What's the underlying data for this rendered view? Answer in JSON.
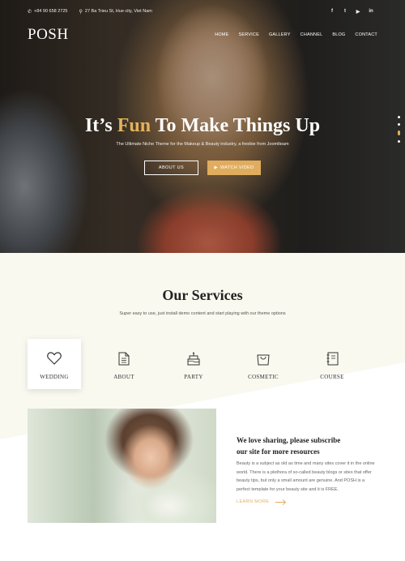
{
  "topbar": {
    "phone": "+84 90 658 2725",
    "address": "27 Ba Trieu St, Hue city, Viet Nam",
    "socials": [
      "f",
      "t",
      "▶",
      "in"
    ]
  },
  "header": {
    "logo": "POSH",
    "nav": [
      "HOME",
      "SERVICE",
      "GALLERY",
      "CHANNEL",
      "BLOG",
      "CONTACT"
    ]
  },
  "hero": {
    "title_before": "It’s ",
    "title_highlight": "Fun",
    "title_after": " To Make Things Up",
    "subtitle": "The Ultimate Niche Theme for the Makeup & Beauty industry, a freebie from Joomlteam",
    "btn_about": "ABOUT US",
    "btn_video": "WATCH VIDEO",
    "slides": 4,
    "active_slide": 3
  },
  "services": {
    "title": "Our Services",
    "subtitle": "Super easy to use, just install demo content and start playing with our theme options",
    "items": [
      {
        "label": "WEDDING",
        "icon": "heart-icon"
      },
      {
        "label": "ABOUT",
        "icon": "document-icon"
      },
      {
        "label": "PARTY",
        "icon": "cake-icon"
      },
      {
        "label": "COSMETIC",
        "icon": "shopping-bag-icon"
      },
      {
        "label": "COURSE",
        "icon": "notebook-icon"
      }
    ],
    "active_index": 0
  },
  "feature": {
    "title_line1": "We love sharing, please subscribe",
    "title_line2": "our site for more resources",
    "text": "Beauty is a subject as old as time and many sites cover it in the online world. There is a plethora of so-called beauty blogs or sites that offer beauty tips, but only a small amount are genuine. And POSH is a perfect template for your beauty site and it is FREE.",
    "learn_more": "LEARN MORE"
  },
  "colors": {
    "accent": "#e0ad5e",
    "section_bg": "#f9f9f0"
  }
}
